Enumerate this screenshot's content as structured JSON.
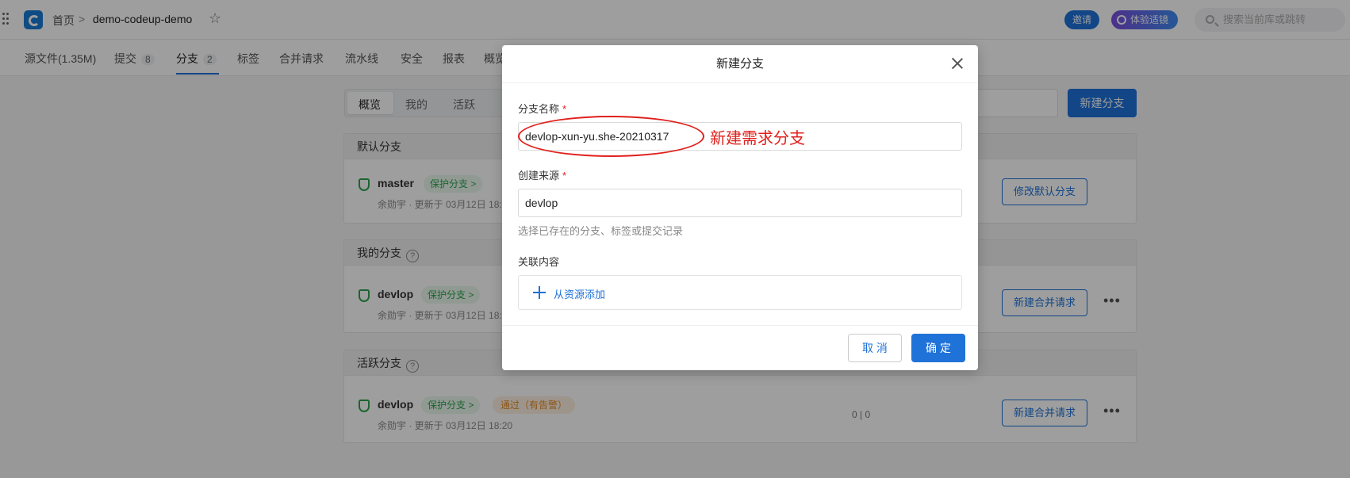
{
  "header": {
    "home": "首页",
    "sep": ">",
    "repo": "demo-codeup-demo",
    "invite": "邀请",
    "trial": "体验适镜",
    "search_placeholder": "搜索当前库或跳转"
  },
  "tabs": [
    {
      "label": "源文件(1.35M)"
    },
    {
      "label": "提交",
      "count": "8"
    },
    {
      "label": "分支",
      "count": "2"
    },
    {
      "label": "标签"
    },
    {
      "label": "合并请求"
    },
    {
      "label": "流水线"
    },
    {
      "label": "安全"
    },
    {
      "label": "报表"
    },
    {
      "label": "概览"
    }
  ],
  "segments": [
    "概览",
    "我的",
    "活跃"
  ],
  "new_branch_button": "新建分支",
  "sections": {
    "default": {
      "title": "默认分支",
      "branch": "master",
      "tag": "保护分支 >",
      "meta": "余勋宇 · 更新于 03月12日 18:20",
      "action": "修改默认分支"
    },
    "mine": {
      "title": "我的分支",
      "branch": "devlop",
      "tag": "保护分支 >",
      "meta": "余勋宇 · 更新于 03月12日 18:20",
      "action": "新建合并请求"
    },
    "active": {
      "title": "活跃分支",
      "branch": "devlop",
      "tag": "保护分支 >",
      "status": "通过（有告警）",
      "meta": "余勋宇 · 更新于 03月12日 18:20",
      "ahead_behind": "0 | 0",
      "action": "新建合并请求"
    }
  },
  "modal": {
    "title": "新建分支",
    "name_label": "分支名称",
    "name_value": "devlop-xun-yu.she-20210317",
    "source_label": "创建来源",
    "source_value": "devlop",
    "source_hint": "选择已存在的分支、标签或提交记录",
    "related_label": "关联内容",
    "add_from_resource": "从资源添加",
    "cancel": "取 消",
    "ok": "确 定",
    "required_mark": "*"
  },
  "annotation": {
    "text": "新建需求分支",
    "color": "#e0201c"
  },
  "colors": {
    "primary": "#1f72d8",
    "protect_green": "#2da44e",
    "warn_orange": "#e58a1f"
  }
}
